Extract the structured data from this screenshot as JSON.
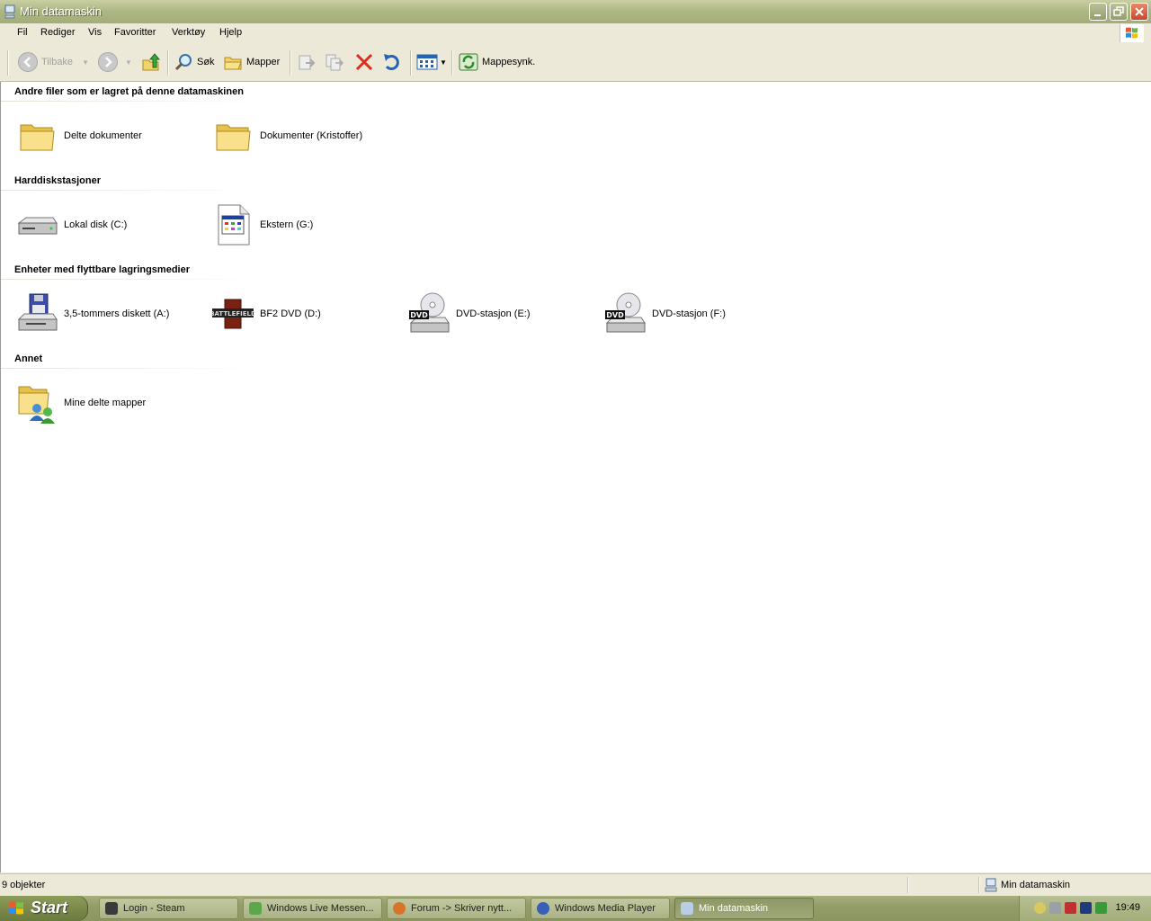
{
  "window": {
    "title": "Min datamaskin"
  },
  "menu": [
    "Fil",
    "Rediger",
    "Vis",
    "Favoritter",
    "Verktøy",
    "Hjelp"
  ],
  "toolbar": {
    "back_label": "Tilbake",
    "search_label": "Søk",
    "folders_label": "Mapper",
    "sync_label": "Mappesynk."
  },
  "groups": [
    {
      "title": "Andre filer som er lagret på denne datamaskinen",
      "items": [
        {
          "label": "Delte dokumenter",
          "icon": "folder-icon"
        },
        {
          "label": "Dokumenter (Kristoffer)",
          "icon": "folder-icon"
        }
      ]
    },
    {
      "title": "Harddiskstasjoner",
      "items": [
        {
          "label": "Lokal disk (C:)",
          "icon": "hard-disk-icon"
        },
        {
          "label": "Ekstern (G:)",
          "icon": "document-icon"
        }
      ]
    },
    {
      "title": "Enheter med flyttbare lagringsmedier",
      "items": [
        {
          "label": "3,5-tommers diskett (A:)",
          "icon": "floppy-drive-icon"
        },
        {
          "label": "BF2 DVD (D:)",
          "icon": "battlefield-icon",
          "icon_text": "BATTLEFIELD"
        },
        {
          "label": "DVD-stasjon (E:)",
          "icon": "dvd-drive-icon",
          "icon_text": "DVD"
        },
        {
          "label": "DVD-stasjon (F:)",
          "icon": "dvd-drive-icon",
          "icon_text": "DVD"
        }
      ]
    },
    {
      "title": "Annet",
      "items": [
        {
          "label": "Mine delte mapper",
          "icon": "shared-folder-icon"
        }
      ]
    }
  ],
  "status": {
    "count": "9 objekter",
    "location": "Min datamaskin"
  },
  "taskbar": {
    "start_label": "Start",
    "tasks": [
      {
        "label": "Login - Steam",
        "icon": "steam-icon"
      },
      {
        "label": "Windows Live Messen...",
        "icon": "messenger-icon"
      },
      {
        "label": "Forum -> Skriver nytt...",
        "icon": "firefox-icon"
      },
      {
        "label": "Windows Media Player",
        "icon": "media-player-icon"
      },
      {
        "label": "Min datamaskin",
        "icon": "computer-icon",
        "active": true
      }
    ],
    "clock": "19:49"
  }
}
